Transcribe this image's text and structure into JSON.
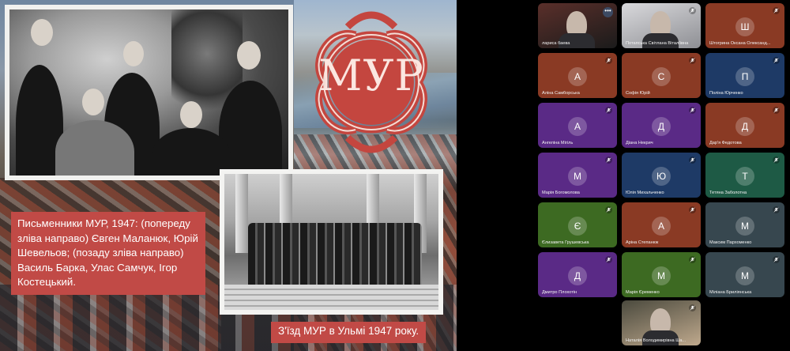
{
  "slide": {
    "logo_text": "МУР",
    "caption_main": "Письменники МУР, 1947: (попереду зліва направо) Євген Маланюк, Юрій Шевельов; (позаду зліва направо) Василь Барка, Улас Самчук, Ігор Костецький.",
    "caption_strip": "З'їзд МУР в Ульмі 1947 року."
  },
  "colors": {
    "caption_bg": "#c14a46",
    "logo_red": "#c4463f"
  },
  "participants": [
    {
      "name": "лариса баева",
      "type": "video",
      "more_menu": "•••"
    },
    {
      "name": "Потапська Світлана Віталіївна",
      "type": "video"
    },
    {
      "name": "Штогрина Оксана Олександ...",
      "initial": "Ш",
      "color": "#8a3a24"
    },
    {
      "name": "Аліна Самборська",
      "initial": "А",
      "color": "#8a3a24"
    },
    {
      "name": "Софія Юрій",
      "initial": "С",
      "color": "#8a3a24"
    },
    {
      "name": "Поліна Юрченко",
      "initial": "П",
      "color": "#1e3a66"
    },
    {
      "name": "Ангеліна Мігіль",
      "initial": "А",
      "color": "#5a2a86"
    },
    {
      "name": "Діана Некрич",
      "initial": "Д",
      "color": "#5a2a86"
    },
    {
      "name": "Дар'я Федотова",
      "initial": "Д",
      "color": "#8a3a24"
    },
    {
      "name": "Марія Богомолова",
      "initial": "М",
      "color": "#5a2a86"
    },
    {
      "name": "Юлія Михальченко",
      "initial": "Ю",
      "color": "#1e3a66"
    },
    {
      "name": "Тетяна Заболотна",
      "initial": "Т",
      "color": "#1e5a45"
    },
    {
      "name": "Єлизавета Грушевська",
      "initial": "Є",
      "color": "#3d6a22"
    },
    {
      "name": "Аріна Степанюк",
      "initial": "А",
      "color": "#8a3a24"
    },
    {
      "name": "Максим Пархоменко",
      "initial": "М",
      "color": "#37474f"
    },
    {
      "name": "Дмитро Плохотін",
      "initial": "Д",
      "color": "#5a2a86"
    },
    {
      "name": "Марія Єременко",
      "initial": "М",
      "color": "#3d6a22"
    },
    {
      "name": "Міліана Бриліянська",
      "initial": "М",
      "color": "#37474f"
    },
    {
      "name": "Наталія Володимирівна Ша...",
      "type": "video"
    }
  ]
}
